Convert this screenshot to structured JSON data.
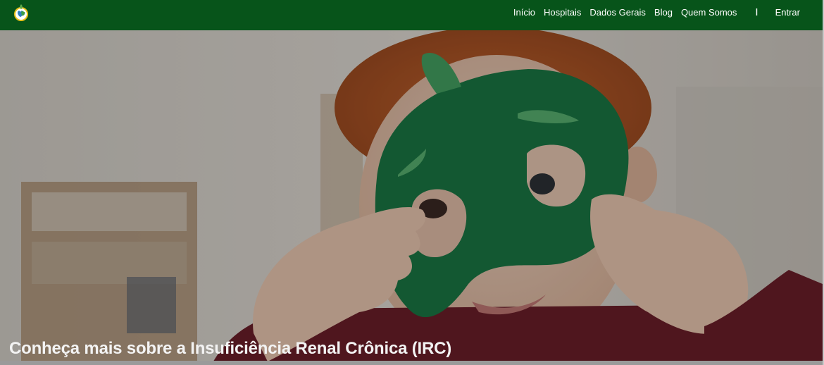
{
  "nav": {
    "logo_icon": "kidney-logo-icon",
    "links": [
      "Início",
      "Hospitais",
      "Dados Gerais",
      "Blog",
      "Quem Somos"
    ],
    "separator": "I",
    "login": "Entrar"
  },
  "hero": {
    "image": "child-green-felt-mask-photo",
    "title": "Conheça mais sobre a Insuficiência Renal Crônica (IRC) e as formas de diálise"
  },
  "colors": {
    "navbar": "#07541a",
    "mask": "#1a7a45",
    "text": "#ffffff"
  }
}
